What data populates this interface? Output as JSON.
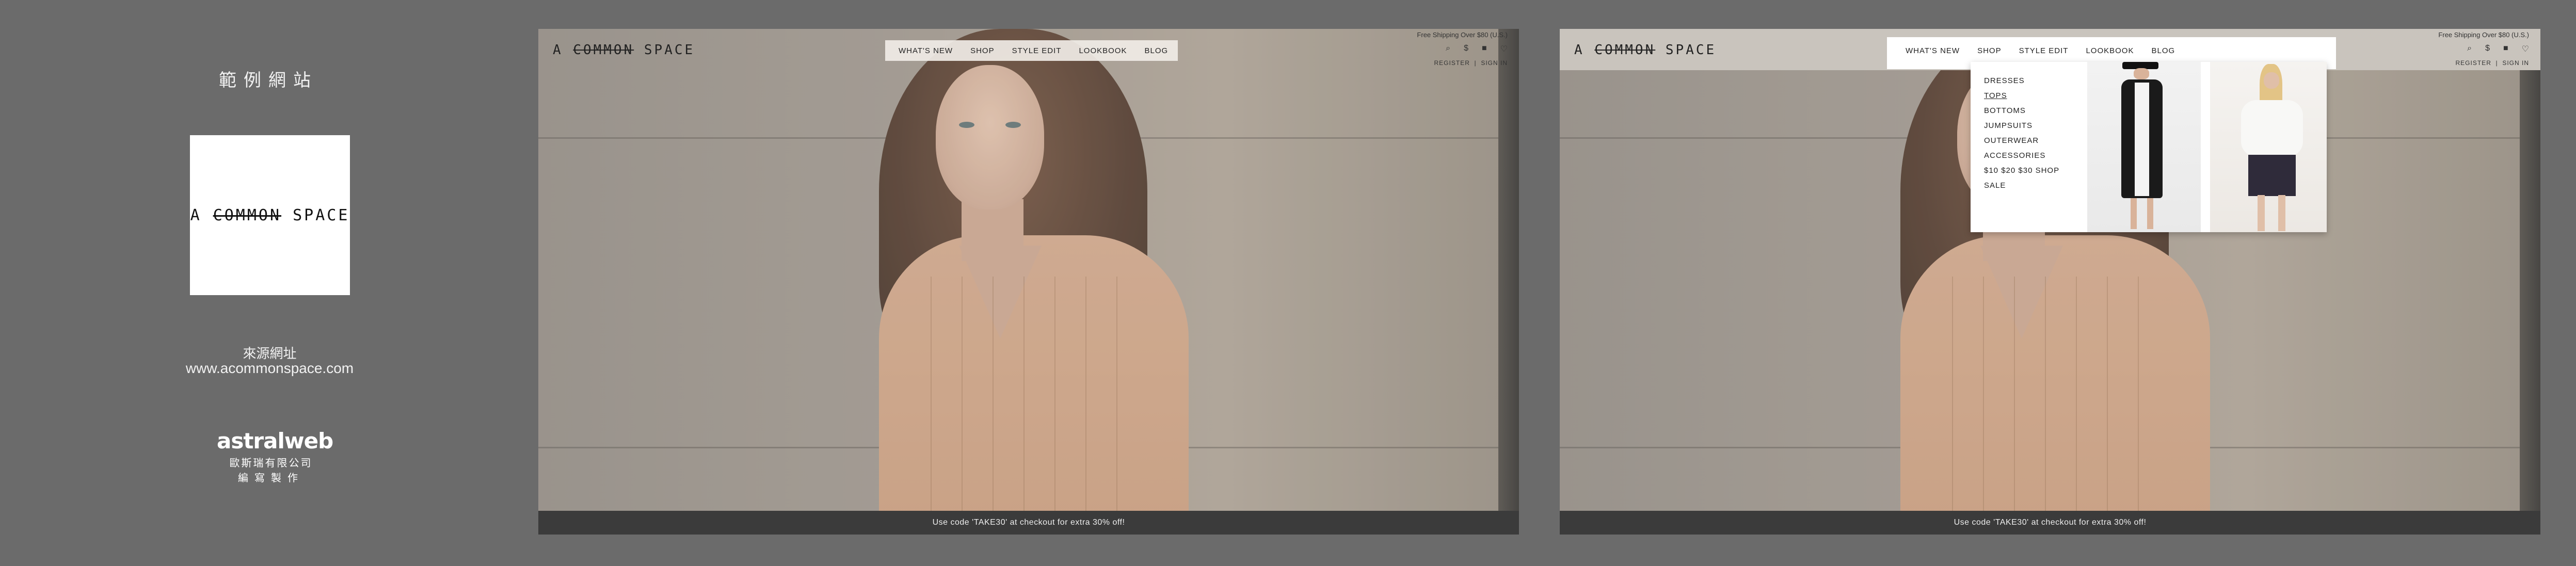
{
  "panel": {
    "title": "範例網站",
    "logo_text_a": "A",
    "logo_text_b": "COMMON",
    "logo_text_c": "SPACE",
    "source_label": "來源網址",
    "source_url": "www.acommonspace.com",
    "brand_name": "astralweb",
    "brand_company": "歐斯瑞有限公司",
    "brand_made": "編寫製作"
  },
  "site": {
    "logo_a": "A",
    "logo_b": "COMMON",
    "logo_c": "SPACE",
    "shipping": "Free Shipping Over $80 (U.S.)",
    "register": "REGISTER",
    "sign_in": "SIGN IN",
    "separator": "|",
    "promo": "Use code 'TAKE30' at checkout for extra 30% off!",
    "nav_frame1": [
      "WHAT'S NEW",
      "SHOP",
      "STYLE EDIT",
      "LOOKBOOK",
      "BLOG"
    ],
    "nav_frame2": [
      "WHAT'S NEW",
      "SHOP",
      "STYLE EDIT",
      "LOOKBOOK",
      "BLOG"
    ],
    "menu": [
      "DRESSES",
      "TOPS",
      "BOTTOMS",
      "JUMPSUITS",
      "OUTERWEAR",
      "ACCESSORIES",
      "$10 $20 $30 SHOP",
      "SALE"
    ],
    "icons": [
      "search-icon",
      "currency-icon",
      "bag-icon",
      "heart-icon"
    ]
  }
}
